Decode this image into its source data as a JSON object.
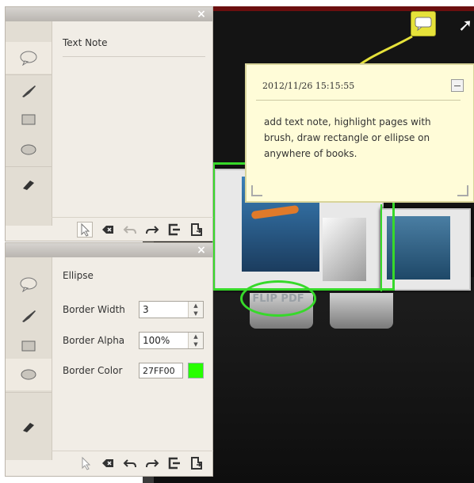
{
  "top_panel": {
    "title": "Text Note",
    "close_glyph": "×",
    "tools": [
      "speech-bubble-icon",
      "brush-icon",
      "rectangle-icon",
      "ellipse-icon",
      "eraser-icon"
    ],
    "actions": [
      "pointer-icon",
      "clear-icon",
      "undo-icon",
      "redo-icon",
      "export-icon",
      "save-icon"
    ]
  },
  "bottom_panel": {
    "title": "Ellipse",
    "close_glyph": "×",
    "border_width": {
      "label": "Border Width",
      "value": "3"
    },
    "border_alpha": {
      "label": "Border Alpha",
      "value": "100%"
    },
    "border_color": {
      "label": "Border Color",
      "value": "27FF00",
      "swatch": "#27ff00"
    }
  },
  "sticky_note": {
    "date": "2012/11/26 15:15:55",
    "text": "add text note, highlight pages with brush, draw rectangle or ellipse on anywhere of books."
  },
  "scene": {
    "badge": "FLIP PDF",
    "highlight_color": "#37d92a"
  }
}
